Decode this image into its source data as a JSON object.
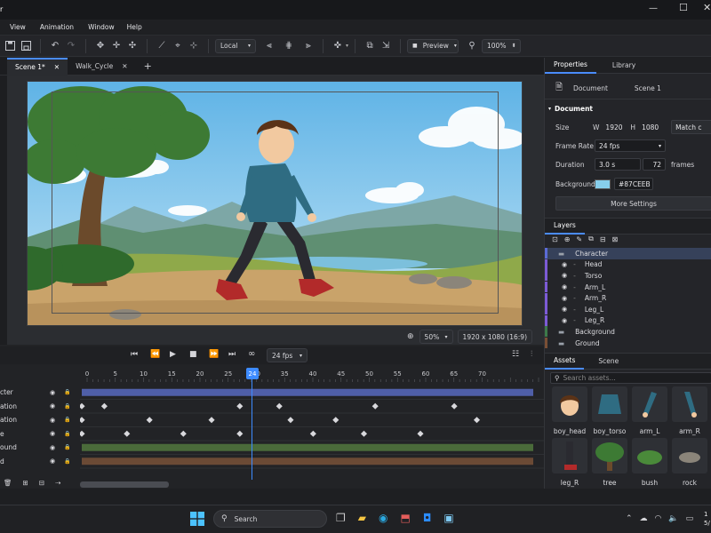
{
  "menu": [
    "View",
    "Animation",
    "Window",
    "Help"
  ],
  "toolbar": {
    "space": "Local",
    "preview": "Preview",
    "zoom": "100%"
  },
  "tabs": [
    {
      "label": "Scene 1*"
    },
    {
      "label": "Walk_Cycle"
    }
  ],
  "viewport": {
    "zoom": "50%",
    "resolution": "1920 x 1080 (16:9)"
  },
  "properties": {
    "tabs": [
      "Properties",
      "Library"
    ],
    "doc_label": "Document",
    "doc_value": "Scene 1",
    "section": "Document",
    "size_label": "Size",
    "w_label": "W",
    "w_value": "1920",
    "h_label": "H",
    "h_value": "1080",
    "match_btn": "Match c",
    "fps_label": "Frame Rate",
    "fps_value": "24 fps",
    "duration_label": "Duration",
    "duration_value": "3.0 s",
    "frames_value": "72",
    "frames_label": "frames",
    "bg_label": "Background",
    "bg_value": "#87CEEB",
    "more_btn": "More Settings"
  },
  "layers": {
    "title": "Layers",
    "items": [
      {
        "name": "Character",
        "indent": 0,
        "color": "#5b6bd6",
        "group": true
      },
      {
        "name": "Head",
        "indent": 1,
        "color": "#7c5bd6"
      },
      {
        "name": "Torso",
        "indent": 1,
        "color": "#7c5bd6"
      },
      {
        "name": "Arm_L",
        "indent": 1,
        "color": "#7c5bd6"
      },
      {
        "name": "Arm_R",
        "indent": 1,
        "color": "#7c5bd6"
      },
      {
        "name": "Leg_L",
        "indent": 1,
        "color": "#7c5bd6"
      },
      {
        "name": "Leg_R",
        "indent": 1,
        "color": "#7c5bd6"
      },
      {
        "name": "Background",
        "indent": 0,
        "color": "#3d7a4a",
        "group": true
      },
      {
        "name": "Ground",
        "indent": 0,
        "color": "#7a4f35",
        "group": true
      }
    ]
  },
  "assets": {
    "tabs": [
      "Assets",
      "Scene"
    ],
    "search_placeholder": "Search assets...",
    "items": [
      "boy_head",
      "boy_torso",
      "arm_L",
      "arm_R",
      "leg_R",
      "tree",
      "bush",
      "rock"
    ]
  },
  "timeline": {
    "fps": "24 fps",
    "current_frame": "24",
    "ticks": [
      "0",
      "5",
      "10",
      "15",
      "20",
      "25",
      "30",
      "35",
      "40",
      "45",
      "50",
      "55",
      "60",
      "65",
      "70"
    ],
    "tracks": [
      "cter",
      "ation",
      "ation",
      "e",
      "ound",
      "d"
    ]
  },
  "taskbar": {
    "search": "Search",
    "time": "1",
    "date": "5/"
  }
}
